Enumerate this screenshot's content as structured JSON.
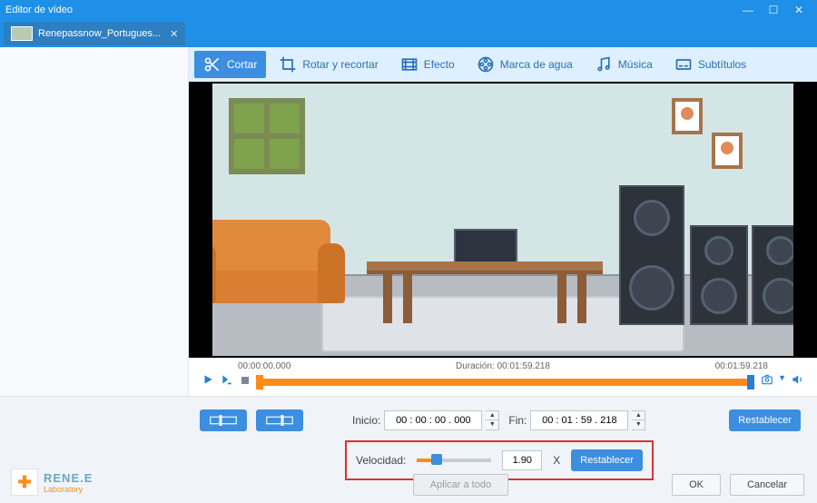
{
  "titlebar": {
    "title": "Editor de vídeo"
  },
  "tab": {
    "filename": "Renepassnow_Portugues..."
  },
  "toolbar": {
    "cut": "Cortar",
    "rotate": "Rotar y recortar",
    "effect": "Efecto",
    "watermark": "Marca de agua",
    "music": "Música",
    "subtitles": "Subtítulos"
  },
  "timeline": {
    "start": "00:00:00.000",
    "duration_label": "Duración:",
    "duration": "00:01:59.218",
    "end": "00:01:59.218"
  },
  "inputs": {
    "start_label": "Inicio:",
    "start_value": "00 : 00 : 00 . 000",
    "end_label": "Fin:",
    "end_value": "00 : 01 : 59 . 218",
    "reset": "Restablecer",
    "speed_label": "Velocidad:",
    "speed_value": "1.90",
    "speed_suffix": "X",
    "speed_reset": "Restablecer"
  },
  "footer": {
    "apply_all": "Aplicar a todo",
    "ok": "OK",
    "cancel": "Cancelar"
  },
  "brand": {
    "name": "RENE.E",
    "sub": "Laboratory"
  }
}
